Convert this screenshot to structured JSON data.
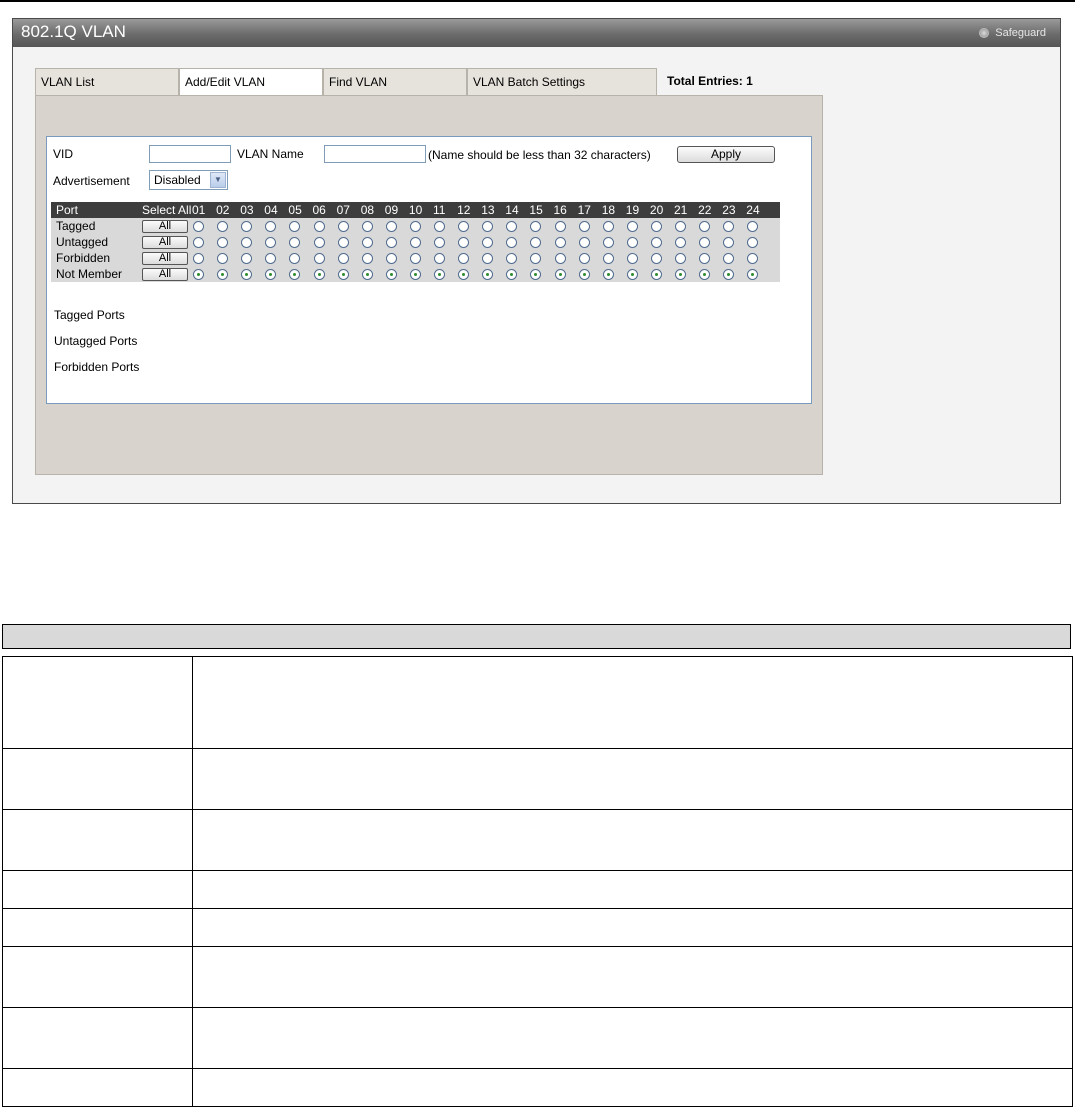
{
  "panel": {
    "title": "802.1Q VLAN",
    "safeguard": "Safeguard"
  },
  "tabs": [
    {
      "label": "VLAN List",
      "active": false
    },
    {
      "label": "Add/Edit VLAN",
      "active": true
    },
    {
      "label": "Find VLAN",
      "active": false
    },
    {
      "label": "VLAN Batch Settings",
      "active": false
    }
  ],
  "total_entries": "Total Entries: 1",
  "form": {
    "vid_label": "VID",
    "vid_value": "",
    "vlan_name_label": "VLAN Name",
    "vlan_name_value": "",
    "name_hint": "(Name should be less than 32 characters)",
    "apply_label": "Apply",
    "advertisement_label": "Advertisement",
    "advertisement_value": "Disabled"
  },
  "port_table": {
    "port_header": "Port",
    "select_all_header": "Select All",
    "ports": [
      "01",
      "02",
      "03",
      "04",
      "05",
      "06",
      "07",
      "08",
      "09",
      "10",
      "11",
      "12",
      "13",
      "14",
      "15",
      "16",
      "17",
      "18",
      "19",
      "20",
      "21",
      "22",
      "23",
      "24"
    ],
    "rows": [
      {
        "label": "Tagged",
        "button": "All",
        "selected": false
      },
      {
        "label": "Untagged",
        "button": "All",
        "selected": false
      },
      {
        "label": "Forbidden",
        "button": "All",
        "selected": false
      },
      {
        "label": "Not Member",
        "button": "All",
        "selected": true
      }
    ]
  },
  "port_lists": {
    "tagged": "Tagged Ports",
    "untagged": "Untagged Ports",
    "forbidden": "Forbidden Ports"
  },
  "colors": {
    "title_bar": "#6b6b6b",
    "content_bg": "#d8d3cc",
    "form_border": "#7a9bbd",
    "port_header_bg": "#3d3d3d",
    "radio_selected": "#2e8b2e"
  }
}
